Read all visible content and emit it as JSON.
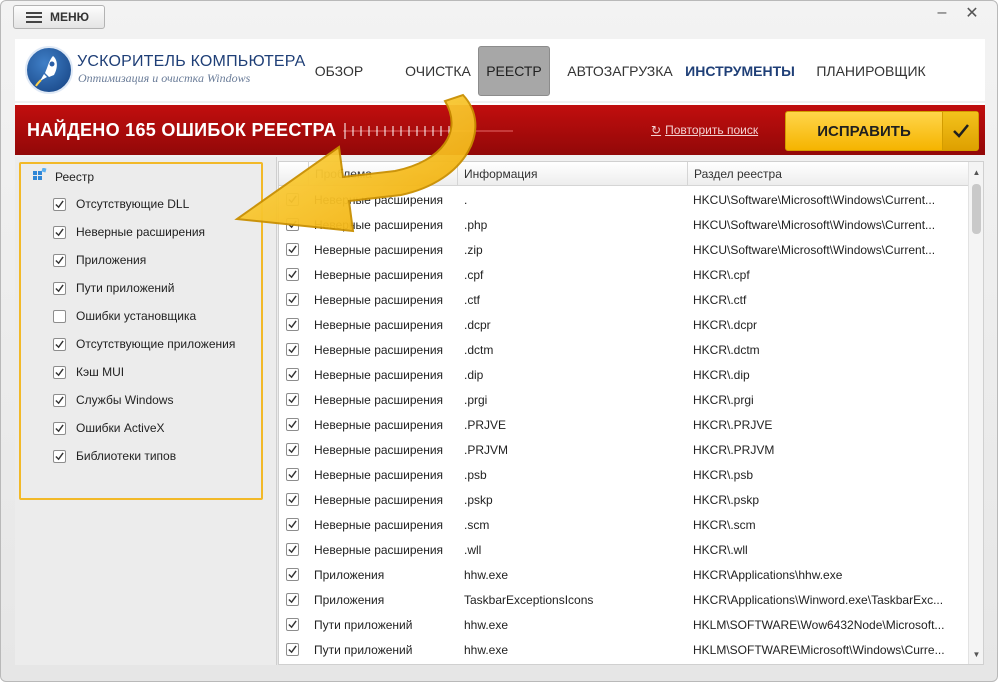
{
  "titlebar": {
    "menu_label": "МЕНЮ"
  },
  "app": {
    "title": "УСКОРИТЕЛЬ КОМПЬЮТЕРА",
    "subtitle": "Оптимизация и очистка Windows"
  },
  "nav": {
    "overview": "ОБЗОР",
    "cleanup": "ОЧИСТКА",
    "registry": "РЕЕСТР",
    "startup": "АВТОЗАГРУЗКА",
    "tools": "ИНСТРУМЕНТЫ",
    "scheduler": "ПЛАНИРОВЩИК"
  },
  "banner": {
    "title": "НАЙДЕНО 165 ОШИБОК РЕЕСТРА",
    "retry_label": "Повторить поиск",
    "fix_label": "ИСПРАВИТЬ"
  },
  "tree": {
    "root_label": "Реестр",
    "items": [
      {
        "label": "Отсутствующие DLL",
        "checked": true
      },
      {
        "label": "Неверные расширения",
        "checked": true
      },
      {
        "label": "Приложения",
        "checked": true
      },
      {
        "label": "Пути приложений",
        "checked": true
      },
      {
        "label": "Ошибки установщика",
        "checked": false
      },
      {
        "label": "Отсутствующие приложения",
        "checked": true
      },
      {
        "label": "Кэш MUI",
        "checked": true
      },
      {
        "label": "Службы Windows",
        "checked": true
      },
      {
        "label": "Ошибки ActiveX",
        "checked": true
      },
      {
        "label": "Библиотеки типов",
        "checked": true
      }
    ]
  },
  "table": {
    "headers": {
      "problem": "Проблема",
      "info": "Информация",
      "section": "Раздел реестра"
    },
    "rows": [
      {
        "problem": "Неверные расширения",
        "info": ".",
        "section": "HKCU\\Software\\Microsoft\\Windows\\Current..."
      },
      {
        "problem": "Неверные расширения",
        "info": ".php",
        "section": "HKCU\\Software\\Microsoft\\Windows\\Current..."
      },
      {
        "problem": "Неверные расширения",
        "info": ".zip",
        "section": "HKCU\\Software\\Microsoft\\Windows\\Current..."
      },
      {
        "problem": "Неверные расширения",
        "info": ".cpf",
        "section": "HKCR\\.cpf"
      },
      {
        "problem": "Неверные расширения",
        "info": ".ctf",
        "section": "HKCR\\.ctf"
      },
      {
        "problem": "Неверные расширения",
        "info": ".dcpr",
        "section": "HKCR\\.dcpr"
      },
      {
        "problem": "Неверные расширения",
        "info": ".dctm",
        "section": "HKCR\\.dctm"
      },
      {
        "problem": "Неверные расширения",
        "info": ".dip",
        "section": "HKCR\\.dip"
      },
      {
        "problem": "Неверные расширения",
        "info": ".prgi",
        "section": "HKCR\\.prgi"
      },
      {
        "problem": "Неверные расширения",
        "info": ".PRJVE",
        "section": "HKCR\\.PRJVE"
      },
      {
        "problem": "Неверные расширения",
        "info": ".PRJVM",
        "section": "HKCR\\.PRJVM"
      },
      {
        "problem": "Неверные расширения",
        "info": ".psb",
        "section": "HKCR\\.psb"
      },
      {
        "problem": "Неверные расширения",
        "info": ".pskp",
        "section": "HKCR\\.pskp"
      },
      {
        "problem": "Неверные расширения",
        "info": ".scm",
        "section": "HKCR\\.scm"
      },
      {
        "problem": "Неверные расширения",
        "info": ".wll",
        "section": "HKCR\\.wll"
      },
      {
        "problem": "Приложения",
        "info": "hhw.exe",
        "section": "HKCR\\Applications\\hhw.exe"
      },
      {
        "problem": "Приложения",
        "info": "TaskbarExceptionsIcons",
        "section": "HKCR\\Applications\\Winword.exe\\TaskbarExc..."
      },
      {
        "problem": "Пути приложений",
        "info": "hhw.exe",
        "section": "HKLM\\SOFTWARE\\Wow6432Node\\Microsoft..."
      },
      {
        "problem": "Пути приложений",
        "info": "hhw.exe",
        "section": "HKLM\\SOFTWARE\\Microsoft\\Windows\\Curre..."
      }
    ]
  },
  "colors": {
    "accent_red": "#b00b0b",
    "fix_yellow": "#f5b400",
    "highlight": "#f2b928",
    "brand_blue": "#1f3f77"
  }
}
